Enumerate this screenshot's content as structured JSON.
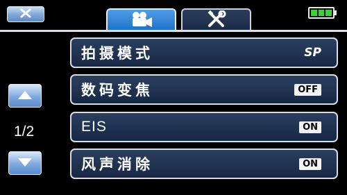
{
  "menu": {
    "items": [
      {
        "label": "拍摄模式",
        "value": "SP"
      },
      {
        "label": "数码变焦",
        "value": "OFF"
      },
      {
        "label": "EIS",
        "value": "ON"
      },
      {
        "label": "风声消除",
        "value": "ON"
      }
    ]
  },
  "pager": {
    "page_indicator": "1/2"
  },
  "tabs": [
    {
      "icon": "video-camera-icon",
      "active": true
    },
    {
      "icon": "wrench-screwdriver-icon",
      "active": false
    }
  ],
  "status": {
    "battery_level": "full",
    "battery_color": "#39d23a"
  },
  "colors": {
    "accent": "#1c6fc9",
    "item_bg": "#172845"
  }
}
